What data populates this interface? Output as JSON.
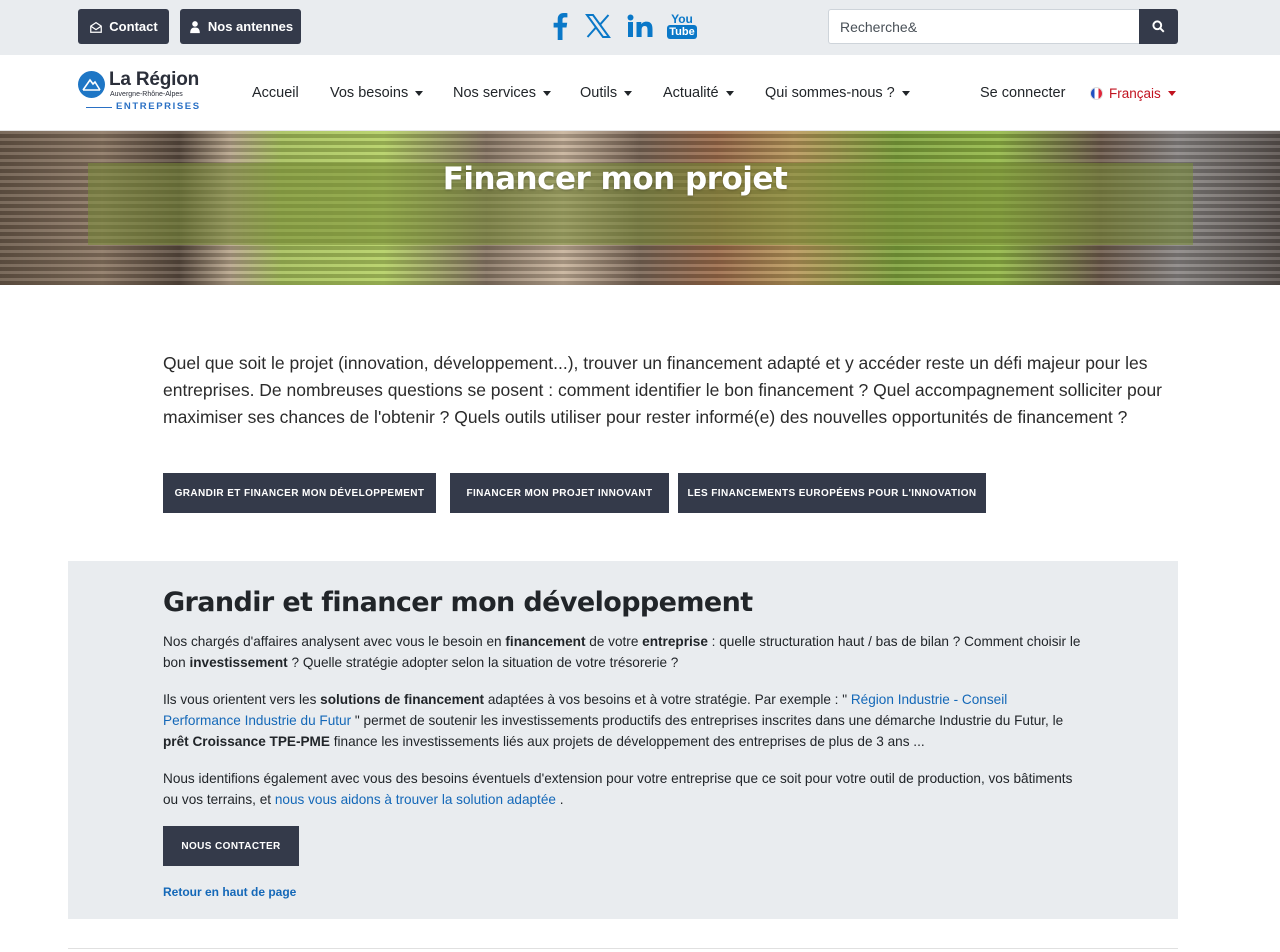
{
  "topbar": {
    "contact_label": "Contact",
    "antennes_label": "Nos antennes",
    "social": [
      "facebook-icon",
      "x-icon",
      "linkedin-icon",
      "youtube-icon"
    ],
    "youtube_text_top": "You",
    "youtube_text_bottom": "Tube",
    "search_placeholder": "Recherche&"
  },
  "logo": {
    "title": "La Région",
    "subtitle": "Auvergne-Rhône-Alpes",
    "tagline": "ENTREPRISES"
  },
  "nav": {
    "items": [
      {
        "label": "Accueil"
      },
      {
        "label": "Vos besoins"
      },
      {
        "label": "Nos services"
      },
      {
        "label": "Outils"
      },
      {
        "label": "Actualité"
      },
      {
        "label": "Qui sommes-nous ?"
      }
    ],
    "login": "Se connecter",
    "language": "Français"
  },
  "hero": {
    "title": "Financer mon projet"
  },
  "intro": {
    "text": "Quel que soit le projet (innovation, développement...), trouver un financement adapté et y accéder reste un défi majeur pour les entreprises. De nombreuses questions se posent : comment identifier le bon financement ? Quel accompagnement solliciter pour maximiser ses chances de l'obtenir ?  Quels outils utiliser pour rester informé(e) des nouvelles opportunités de financement ?"
  },
  "ctas": [
    {
      "label": "GRANDIR ET FINANCER MON DÉVELOPPEMENT"
    },
    {
      "label": "FINANCER MON PROJET INNOVANT"
    },
    {
      "label": "LES FINANCEMENTS EUROPÉENS POUR L'INNOVATION"
    }
  ],
  "section": {
    "title": "Grandir et financer mon développement",
    "p1": {
      "t1": "Nos chargés d'affaires analysent avec vous le besoin en ",
      "b1": "financement",
      "t2": " de votre ",
      "b2": "entreprise",
      "t3": " : quelle structuration haut / bas de bilan ? Comment choisir le bon ",
      "b3": "investissement",
      "t4": " ? Quelle stratégie adopter selon la situation de votre trésorerie ?"
    },
    "p2": {
      "t1": "Ils vous orientent vers les ",
      "b1": "solutions de financement",
      "t2": " adaptées à vos besoins et à votre stratégie. Par exemple : \" ",
      "link": "Région Industrie - Conseil Performance Industrie du Futur",
      "t3": " \" permet de soutenir les investissements productifs des entreprises inscrites dans une démarche Industrie du Futur, le ",
      "b2": "prêt Croissance TPE-PME",
      "t4": " finance les investissements liés aux projets de développement des entreprises de plus de 3 ans ..."
    },
    "p3": {
      "t1": "Nous identifions également avec vous des besoins éventuels d'extension pour votre entreprise que ce soit pour votre outil de production, vos bâtiments ou vos terrains, et ",
      "link": "nous vous aidons à trouver la solution adaptée",
      "t2": " ."
    },
    "contact_button": "NOUS CONTACTER",
    "back_to_top": "Retour en haut de page"
  },
  "colors": {
    "dark_button": "#343a4a",
    "link": "#1468b8",
    "social_blue": "#0a78c8",
    "section_bg": "#e9ecef",
    "language_red": "#c1121f"
  }
}
